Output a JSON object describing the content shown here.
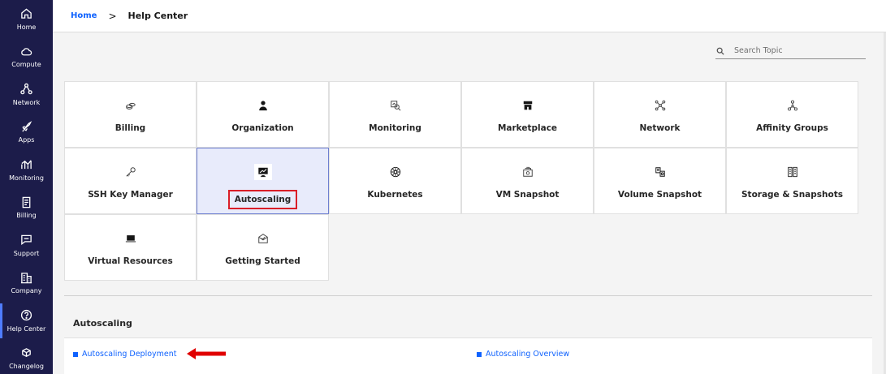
{
  "sidebar": {
    "items": [
      {
        "label": "Home",
        "icon": "home-icon"
      },
      {
        "label": "Compute",
        "icon": "cloud-icon"
      },
      {
        "label": "Network",
        "icon": "network-icon"
      },
      {
        "label": "Apps",
        "icon": "rocket-icon"
      },
      {
        "label": "Monitoring",
        "icon": "chart-icon"
      },
      {
        "label": "Billing",
        "icon": "receipt-icon"
      },
      {
        "label": "Support",
        "icon": "chat-icon"
      },
      {
        "label": "Company",
        "icon": "building-icon"
      },
      {
        "label": "Help Center",
        "icon": "help-icon",
        "active": true
      },
      {
        "label": "Changelog",
        "icon": "changelog-icon"
      }
    ]
  },
  "breadcrumb": {
    "home": "Home",
    "separator": ">",
    "current": "Help Center"
  },
  "search": {
    "placeholder": "Search Topic",
    "value": ""
  },
  "topics": [
    {
      "label": "Billing",
      "icon": "billing-icon"
    },
    {
      "label": "Organization",
      "icon": "person-icon"
    },
    {
      "label": "Monitoring",
      "icon": "monitoring-icon"
    },
    {
      "label": "Marketplace",
      "icon": "store-icon"
    },
    {
      "label": "Network",
      "icon": "network-nodes-icon"
    },
    {
      "label": "Affinity Groups",
      "icon": "hierarchy-icon"
    },
    {
      "label": "SSH Key Manager",
      "icon": "key-icon"
    },
    {
      "label": "Autoscaling",
      "icon": "autoscaling-icon",
      "selected": true
    },
    {
      "label": "Kubernetes",
      "icon": "kubernetes-icon"
    },
    {
      "label": "VM Snapshot",
      "icon": "vm-snapshot-icon"
    },
    {
      "label": "Volume Snapshot",
      "icon": "volume-snapshot-icon"
    },
    {
      "label": "Storage & Snapshots",
      "icon": "storage-icon"
    },
    {
      "label": "Virtual Resources",
      "icon": "laptop-icon"
    },
    {
      "label": "Getting Started",
      "icon": "getting-started-icon"
    }
  ],
  "panel": {
    "title": "Autoscaling",
    "articles": [
      {
        "label": "Autoscaling Deployment"
      },
      {
        "label": "Autoscaling Overview"
      }
    ]
  },
  "colors": {
    "sidebar_bg": "#1c1c4a",
    "link": "#0f62fe",
    "selected_tile_bg": "#e8ebfb",
    "highlight": "#da1e28"
  }
}
